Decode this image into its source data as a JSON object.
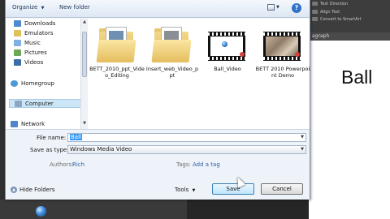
{
  "window": {
    "toolbar": {
      "organize_label": "Organize",
      "new_folder_label": "New folder",
      "caret": "▼",
      "help_label": "?"
    },
    "nav": {
      "items": [
        {
          "label": "Downloads",
          "icon": "downloads-icon"
        },
        {
          "label": "Emulators",
          "icon": "folder-icon"
        },
        {
          "label": "Music",
          "icon": "music-icon"
        },
        {
          "label": "Pictures",
          "icon": "pictures-icon"
        },
        {
          "label": "Videos",
          "icon": "videos-icon"
        },
        {
          "label": "Homegroup",
          "icon": "homegroup-icon"
        },
        {
          "label": "Computer",
          "icon": "computer-icon",
          "selected": true
        },
        {
          "label": "Network",
          "icon": "network-icon"
        }
      ]
    },
    "files": [
      {
        "name": "BETT_2010_ppt_Video_Editing",
        "type": "folder"
      },
      {
        "name": "Insert_web_Video_ppt",
        "type": "folder"
      },
      {
        "name": "Ball_Video",
        "type": "video"
      },
      {
        "name": "BETT 2010 Powerpoint Demo",
        "type": "video"
      }
    ],
    "fields": {
      "file_name_label": "File name:",
      "file_name_value": "Ball",
      "save_as_type_label": "Save as type:",
      "save_as_type_value": "Windows Media Video",
      "authors_label": "Authors:",
      "authors_value": "Rich",
      "tags_label": "Tags:",
      "tags_value": "Add a tag"
    },
    "footer": {
      "hide_folders_label": "Hide Folders",
      "tools_label": "Tools",
      "save_label": "Save",
      "cancel_label": "Cancel"
    }
  },
  "background": {
    "slide_text": "Ball",
    "ribbon_items": [
      "Text Direction",
      "Align Text",
      "Convert to SmartArt"
    ],
    "ribbon_group": "agraph"
  }
}
